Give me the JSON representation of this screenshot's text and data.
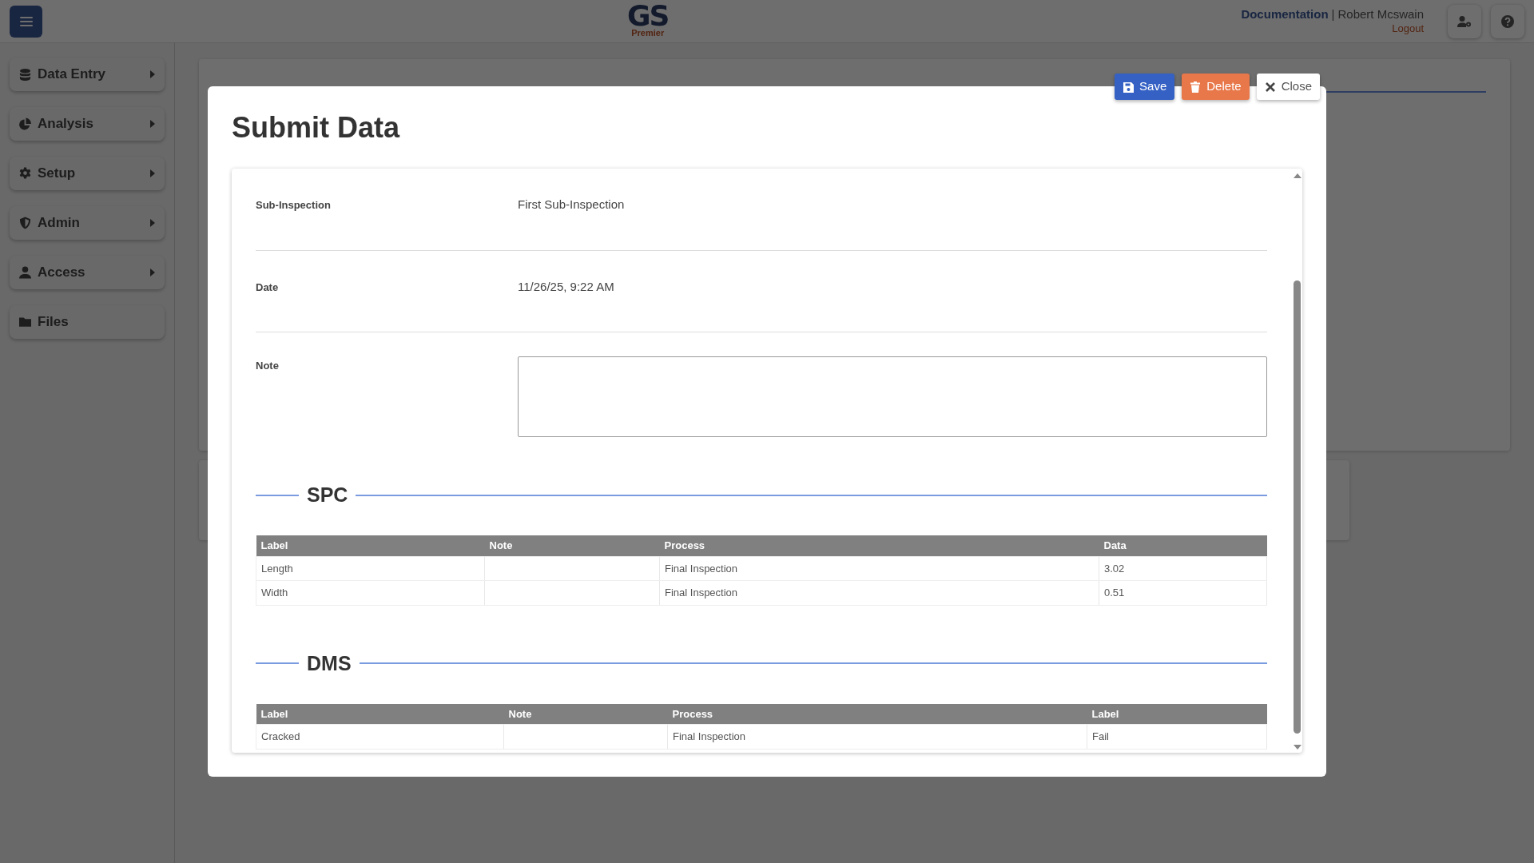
{
  "topbar": {
    "logo": {
      "title": "GS",
      "subtitle": "Premier"
    },
    "link": "Documentation",
    "separator": "|",
    "user": "Robert Mcswain",
    "logout": "Logout"
  },
  "sidebar": {
    "items": [
      {
        "label": "Data Entry",
        "submenu": true
      },
      {
        "label": "Analysis",
        "submenu": true
      },
      {
        "label": "Setup",
        "submenu": true
      },
      {
        "label": "Admin",
        "submenu": true
      },
      {
        "label": "Access",
        "submenu": true
      },
      {
        "label": "Files",
        "submenu": false
      }
    ]
  },
  "modal": {
    "title": "Submit Data",
    "buttons": [
      {
        "label": "Save",
        "kind": "save"
      },
      {
        "label": "Delete",
        "kind": "delete"
      },
      {
        "label": "Close",
        "kind": "close"
      }
    ],
    "fields": [
      {
        "label": "Sub-Inspection",
        "kind": "text",
        "value": "First Sub-Inspection"
      },
      {
        "label": "Date",
        "kind": "text",
        "value": "11/26/25, 9:22 AM"
      },
      {
        "label": "Note",
        "kind": "textarea"
      }
    ],
    "sections": [
      {
        "title": "SPC",
        "columns": [
          "Label",
          "Note",
          "Process",
          "Data"
        ],
        "rows": [
          [
            "Length",
            "",
            "Final Inspection",
            "3.02"
          ],
          [
            "Width",
            "",
            "Final Inspection",
            "0.51"
          ]
        ]
      },
      {
        "title": "DMS",
        "columns": [
          "Label",
          "Note",
          "Process",
          "Label"
        ],
        "rows": [
          [
            "Cracked",
            "",
            "Final Inspection",
            "Fail"
          ]
        ]
      }
    ]
  }
}
